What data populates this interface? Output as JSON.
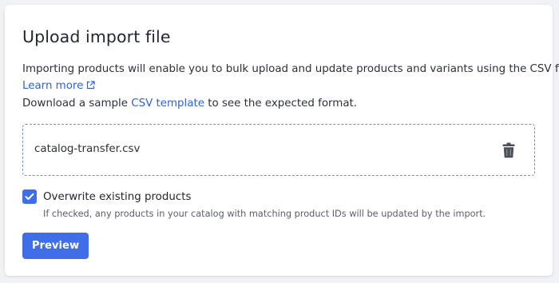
{
  "card": {
    "title": "Upload import file",
    "description": "Importing products will enable you to bulk upload and update products and variants using the CSV file.",
    "learn_more": "Learn more",
    "download_prefix": "Download a sample ",
    "csv_template_link": "CSV template",
    "download_suffix": " to see the expected format."
  },
  "file": {
    "name": "catalog-transfer.csv",
    "delete_icon": "trash-icon"
  },
  "overwrite": {
    "checked": true,
    "label": "Overwrite existing products",
    "help": "If checked, any products in your catalog with matching product IDs will be updated by the import."
  },
  "actions": {
    "preview_label": "Preview"
  },
  "colors": {
    "primary": "#3f6ee8",
    "link": "#2f62d8",
    "dropzone_border": "#6e8ecf"
  }
}
